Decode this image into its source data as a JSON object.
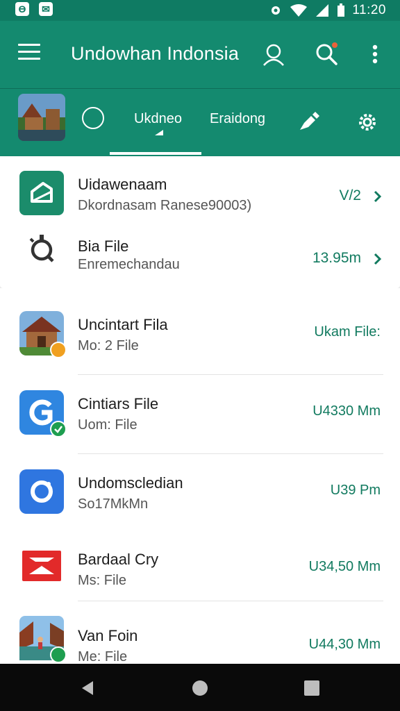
{
  "status_bar": {
    "time": "11:20"
  },
  "toolbar": {
    "title": "Undowhan Indonsia"
  },
  "tabs": [
    {
      "label": "Ukdneo"
    },
    {
      "label": "Eraidong"
    }
  ],
  "top_card": [
    {
      "title": "Uidawenaam",
      "subtitle": "Dkordnasam Ranese90003)",
      "right": "V/2"
    },
    {
      "title": "Bia File",
      "subtitle": "Enremechandau",
      "right": "13.95m"
    }
  ],
  "list": [
    {
      "title": "Uncintart Fila",
      "subtitle": "Mo: 2 File",
      "right": "Ukam File:"
    },
    {
      "title": "Cintiars File",
      "subtitle": "Uom: File",
      "right": "U4330 Mm"
    },
    {
      "title": "Undomscledian",
      "subtitle": "So17MkMn",
      "right": "U39 Pm"
    },
    {
      "title": "Bardaal Cry",
      "subtitle": "Ms: File",
      "right": "U34,50 Mm"
    },
    {
      "title": "Van Foin",
      "subtitle": "Me: File",
      "right": "U44,30 Mm"
    }
  ],
  "colors": {
    "primary": "#148a6f",
    "primary_dark": "#0f7b63",
    "accent_text": "#117a5f"
  }
}
